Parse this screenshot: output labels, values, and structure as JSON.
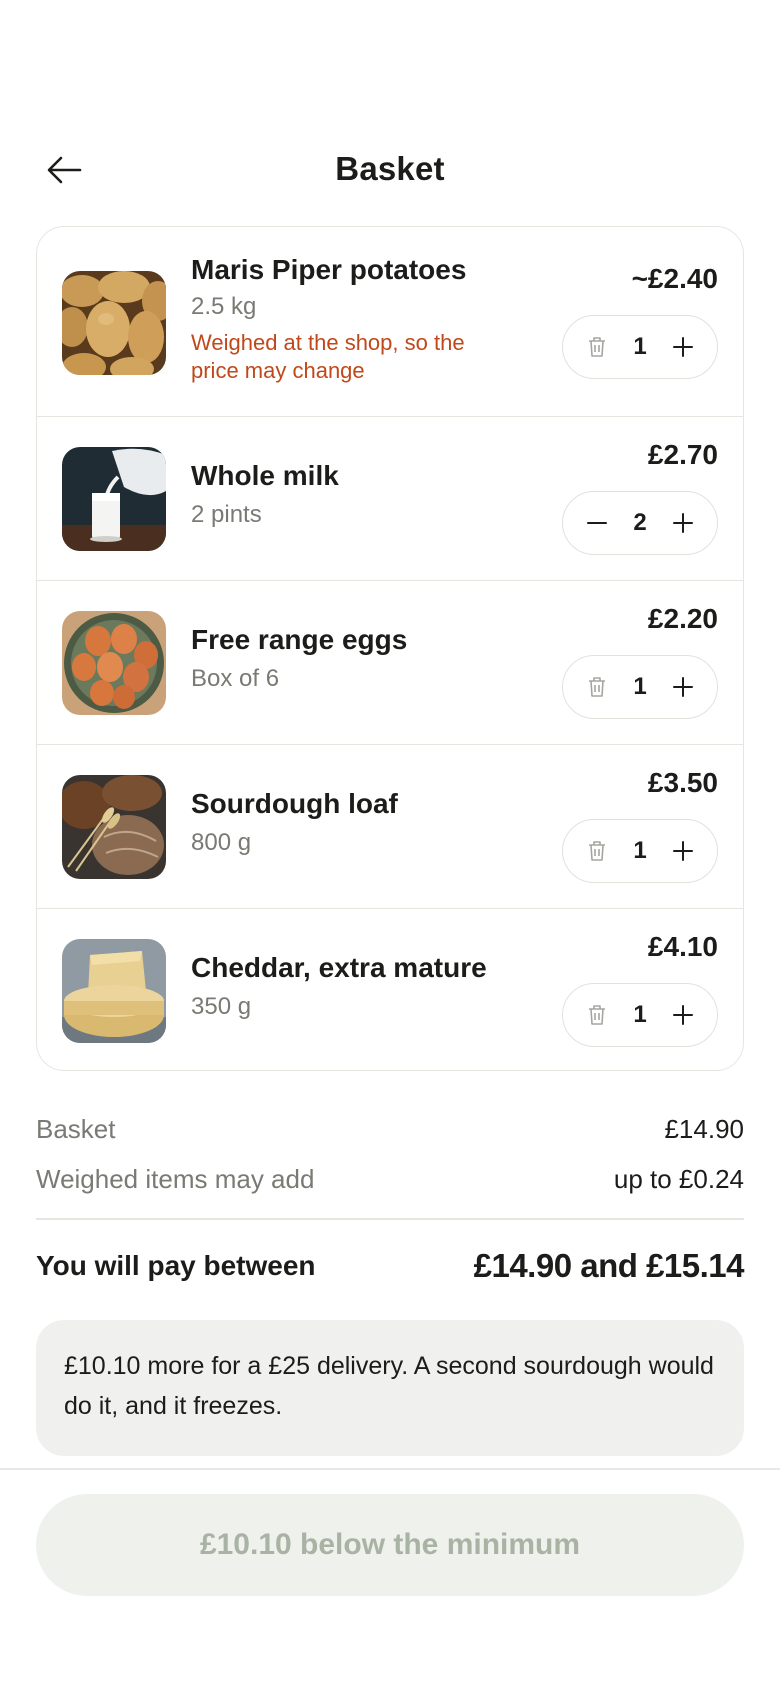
{
  "header": {
    "title": "Basket",
    "back_icon": "arrow-left-icon"
  },
  "items": [
    {
      "name": "Maris Piper potatoes",
      "detail": "2.5 kg",
      "note": "Weighed at the shop, so the price may change",
      "price": "~£2.40",
      "quantity": "1",
      "decrease_icon": "trash-icon",
      "increase_icon": "plus-icon",
      "image": "potatoes"
    },
    {
      "name": "Whole milk",
      "detail": "2 pints",
      "price": "£2.70",
      "quantity": "2",
      "decrease_icon": "minus-icon",
      "increase_icon": "plus-icon",
      "image": "milk"
    },
    {
      "name": "Free range eggs",
      "detail": "Box of 6",
      "price": "£2.20",
      "quantity": "1",
      "decrease_icon": "trash-icon",
      "increase_icon": "plus-icon",
      "image": "eggs"
    },
    {
      "name": "Sourdough loaf",
      "detail": "800 g",
      "price": "£3.50",
      "quantity": "1",
      "decrease_icon": "trash-icon",
      "increase_icon": "plus-icon",
      "image": "sourdough"
    },
    {
      "name": "Cheddar, extra mature",
      "detail": "350 g",
      "price": "£4.10",
      "quantity": "1",
      "decrease_icon": "trash-icon",
      "increase_icon": "plus-icon",
      "image": "cheddar"
    }
  ],
  "summary": {
    "basket_label": "Basket",
    "basket_value": "£14.90",
    "weighed_label": "Weighed items may add",
    "weighed_value": "up to £0.24",
    "total_label": "You will pay between",
    "total_value": "£14.90 and £15.14"
  },
  "hint": "£10.10 more for a £25 delivery. A second sourdough would do it, and it freezes.",
  "checkout": {
    "label": "£10.10 below the minimum"
  },
  "colors": {
    "warning": "#c1481a",
    "muted": "#7a7a74",
    "cta_bg": "#eff1ec",
    "cta_text": "#a9b3a3"
  }
}
